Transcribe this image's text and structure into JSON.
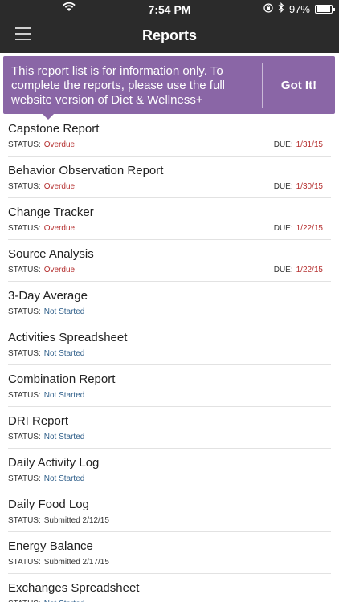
{
  "status_bar": {
    "time": "7:54 PM",
    "battery": "97%",
    "battery_level": 0.97
  },
  "header": {
    "title": "Reports",
    "menu_icon": "hamburger-menu-icon"
  },
  "banner": {
    "message": "This report list is for information only. To complete the reports, please use the full website version of Diet & Wellness+",
    "button_label": "Got It!",
    "background": "#8a66a6"
  },
  "labels": {
    "status": "STATUS:",
    "due": "DUE:"
  },
  "colors": {
    "overdue": "#b53030",
    "not_started": "#2f5f8a",
    "topbar": "#2b2b2b"
  },
  "reports": [
    {
      "title": "Capstone Report",
      "status": "Overdue",
      "status_type": "overdue",
      "due": "1/31/15"
    },
    {
      "title": "Behavior Observation Report",
      "status": "Overdue",
      "status_type": "overdue",
      "due": "1/30/15"
    },
    {
      "title": "Change Tracker",
      "status": "Overdue",
      "status_type": "overdue",
      "due": "1/22/15"
    },
    {
      "title": "Source Analysis",
      "status": "Overdue",
      "status_type": "overdue",
      "due": "1/22/15"
    },
    {
      "title": "3-Day Average",
      "status": "Not Started",
      "status_type": "notstarted",
      "due": ""
    },
    {
      "title": "Activities Spreadsheet",
      "status": "Not Started",
      "status_type": "notstarted",
      "due": ""
    },
    {
      "title": "Combination Report",
      "status": "Not Started",
      "status_type": "notstarted",
      "due": ""
    },
    {
      "title": "DRI Report",
      "status": "Not Started",
      "status_type": "notstarted",
      "due": ""
    },
    {
      "title": "Daily Activity Log",
      "status": "Not Started",
      "status_type": "notstarted",
      "due": ""
    },
    {
      "title": "Daily Food Log",
      "status": "Submitted 2/12/15",
      "status_type": "submitted",
      "due": ""
    },
    {
      "title": "Energy Balance",
      "status": "Submitted 2/17/15",
      "status_type": "submitted",
      "due": ""
    },
    {
      "title": "Exchanges Spreadsheet",
      "status": "Not Started",
      "status_type": "notstarted",
      "due": ""
    }
  ]
}
